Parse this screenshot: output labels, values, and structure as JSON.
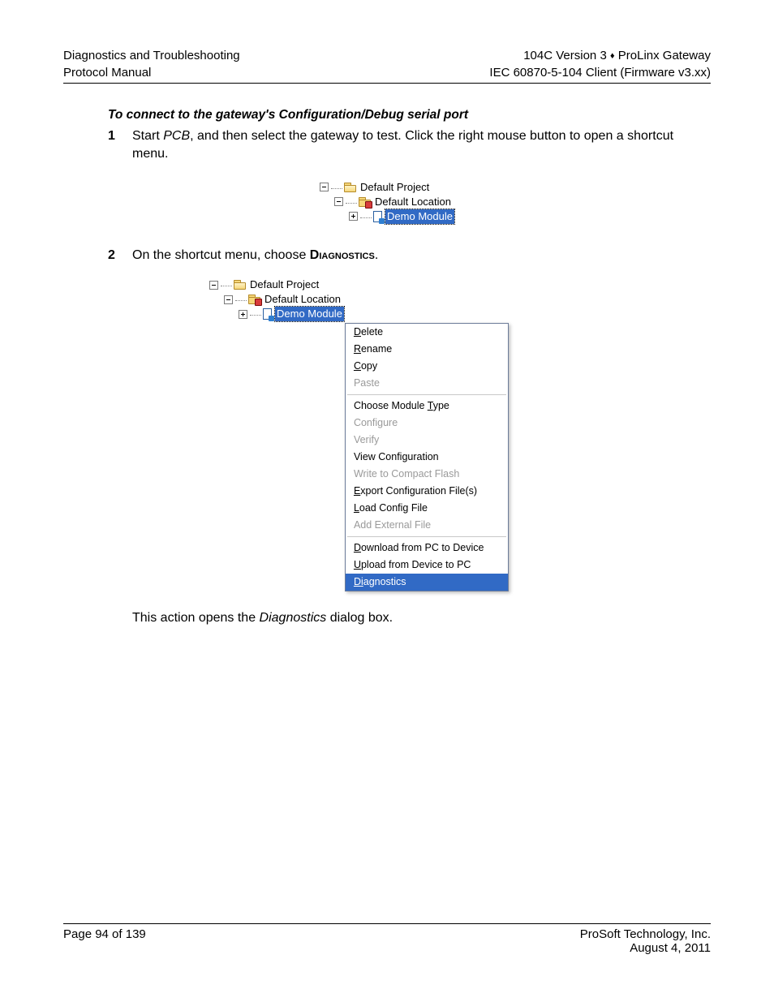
{
  "header": {
    "left_line1": "Diagnostics and Troubleshooting",
    "left_line2": "Protocol Manual",
    "right_line1_a": "104C Version 3",
    "right_line1_sep": "♦",
    "right_line1_b": "ProLinx Gateway",
    "right_line2": "IEC 60870-5-104 Client (Firmware v3.xx)"
  },
  "section_title": "To connect to the gateway's Configuration/Debug serial port",
  "steps": {
    "s1": {
      "num": "1",
      "a": "Start ",
      "pcb": "PCB",
      "b": ", and then select the gateway to test. Click the right mouse button to open a shortcut menu."
    },
    "s2": {
      "num": "2",
      "a": "On the shortcut menu, choose ",
      "bold": "Diagnostics",
      "b": "."
    }
  },
  "tree": {
    "project": "Default Project",
    "location": "Default Location",
    "module": "Demo Module"
  },
  "menu": {
    "delete": "Delete",
    "rename": "Rename",
    "copy": "Copy",
    "paste": "Paste",
    "choose_type": "Choose Module Type",
    "configure": "Configure",
    "verify": "Verify",
    "view_config": "View Configuration",
    "write_cf": "Write to Compact Flash",
    "export": "Export Configuration File(s)",
    "load": "Load Config File",
    "add_ext": "Add External File",
    "download": "Download from PC to Device",
    "upload": "Upload from Device to PC",
    "diagnostics": "Diagnostics"
  },
  "closing": {
    "a": "This action opens the ",
    "i": "Diagnostics",
    "b": " dialog box."
  },
  "footer": {
    "left": "Page 94 of 139",
    "right1": "ProSoft Technology, Inc.",
    "right2": "August 4, 2011"
  }
}
